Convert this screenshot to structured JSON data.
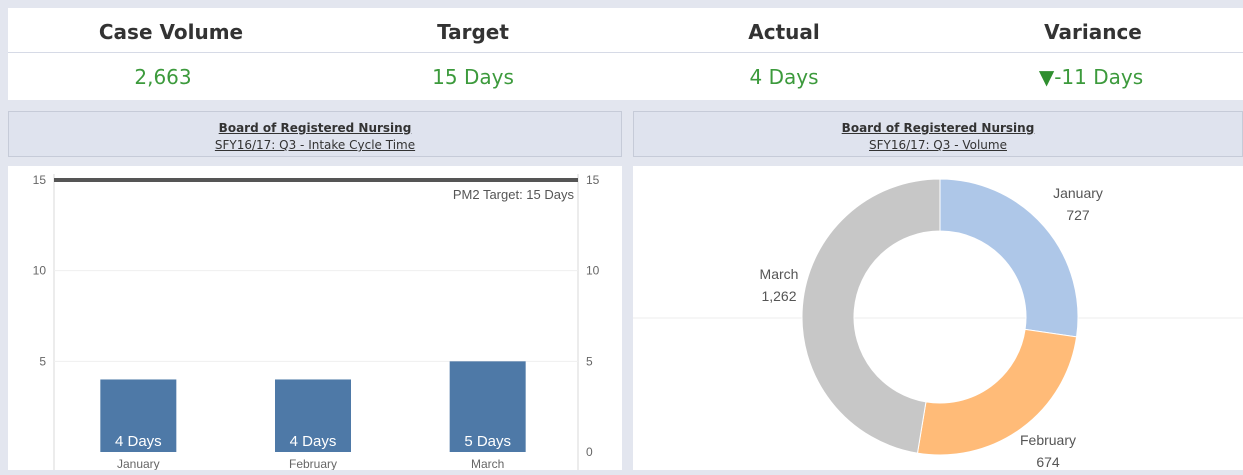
{
  "kpi": {
    "headers": [
      "Case Volume",
      "Target",
      "Actual",
      "Variance"
    ],
    "values": [
      "2,663",
      "15 Days",
      "4 Days",
      "-11 Days"
    ],
    "variance_icon": "down-triangle-icon",
    "value_color": "#3c9a3c"
  },
  "left_panel": {
    "title": "Board of Registered Nursing",
    "subtitle": "SFY16/17: Q3 -  Intake Cycle Time"
  },
  "right_panel": {
    "title": "Board of Registered Nursing",
    "subtitle": "SFY16/17: Q3 - Volume"
  },
  "chart_data": [
    {
      "type": "bar",
      "categories": [
        "January",
        "February",
        "March"
      ],
      "values": [
        4,
        4,
        5
      ],
      "data_labels": [
        "4 Days",
        "4 Days",
        "5 Days"
      ],
      "ylim": [
        0,
        15
      ],
      "left_ticks": [
        5,
        10,
        15
      ],
      "right_ticks": [
        0,
        5,
        10,
        15
      ],
      "target_line": {
        "value": 15,
        "label": "PM2 Target: 15 Days"
      },
      "bar_color": "#4e79a7",
      "target_color": "#555555",
      "grid": true
    },
    {
      "type": "pie",
      "donut": true,
      "slices": [
        {
          "label": "January",
          "value": 727,
          "value_label": "727",
          "color": "#aec7e8"
        },
        {
          "label": "February",
          "value": 674,
          "value_label": "674",
          "color": "#ffbb78"
        },
        {
          "label": "March",
          "value": 1262,
          "value_label": "1,262",
          "color": "#c7c7c7"
        }
      ]
    }
  ]
}
